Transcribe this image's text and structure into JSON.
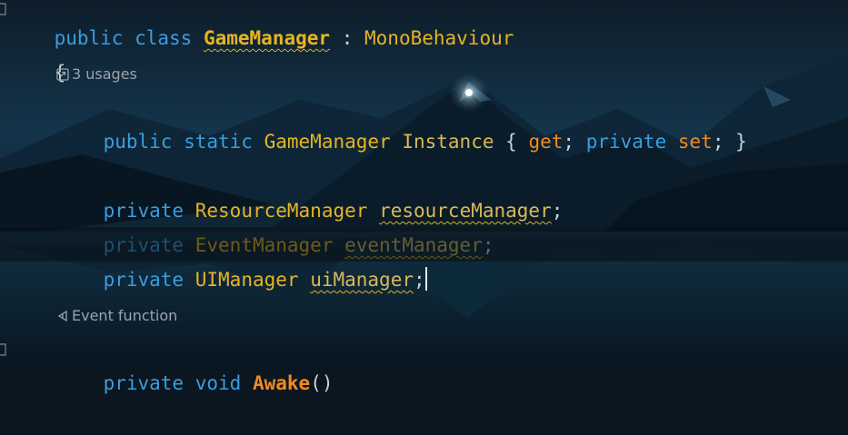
{
  "editor": {
    "class_decl": {
      "kw_public": "public",
      "kw_class": "class",
      "class_name": "GameManager",
      "colon": ":",
      "base_type": "MonoBehaviour"
    },
    "open_brace": "{",
    "usages_hint": "3 usages",
    "instance_line": {
      "kw_public": "public",
      "kw_static": "static",
      "type": "GameManager",
      "name": "Instance",
      "brace_open": "{",
      "get": "get",
      "semi1": ";",
      "kw_private": "private",
      "set": "set",
      "semi2": ";",
      "brace_close": "}"
    },
    "fields": [
      {
        "modifier": "private",
        "type": "ResourceManager",
        "name": "resourceManager",
        "end": ";"
      },
      {
        "modifier": "private",
        "type": "EventManager",
        "name": "eventManager",
        "end": ";"
      },
      {
        "modifier": "private",
        "type": "UIManager",
        "name": "uiManager",
        "end": ";"
      }
    ],
    "event_hint": "Event function",
    "awake_line": {
      "modifier": "private",
      "return_type": "void",
      "name": "Awake",
      "parens": "()"
    }
  },
  "icons": {
    "usages": "arrow-up-right-box-icon",
    "event": "unity-event-icon"
  }
}
